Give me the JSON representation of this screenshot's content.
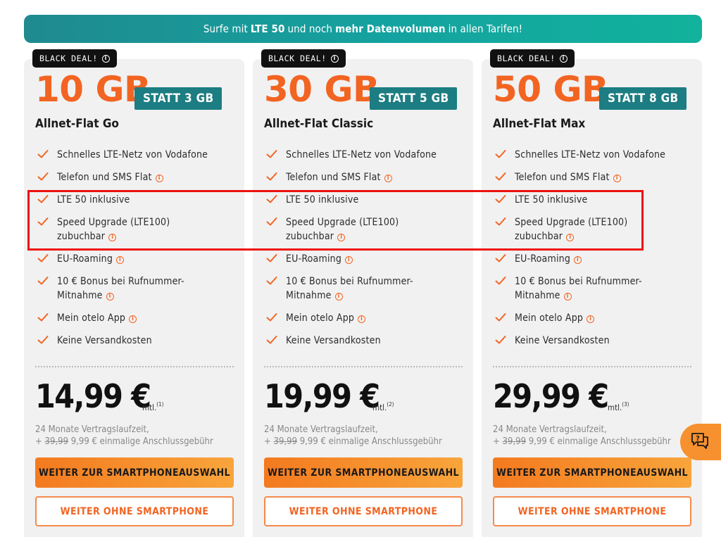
{
  "banner": {
    "text_1": "Surfe mit",
    "bold_1": "LTE 50",
    "text_2": "und noch",
    "bold_2": "mehr Datenvolumen",
    "text_3": "in allen Tarifen!"
  },
  "colors": {
    "accent_orange": "#f26422",
    "teal": "#1c7d82",
    "highlight_red": "#ee1111"
  },
  "plans": [
    {
      "deal_label": "BLACK DEAL!",
      "data_volume": "10 GB",
      "statt": "STATT 3 GB",
      "name": "Allnet-Flat Go",
      "features": [
        {
          "line1": "Schnelles LTE-Netz von Vodafone",
          "line2": "",
          "info": false
        },
        {
          "line1": "Telefon und SMS Flat",
          "line2": "",
          "info": true
        },
        {
          "line1": "LTE 50 inklusive",
          "line2": "",
          "info": false
        },
        {
          "line1": "Speed Upgrade (LTE100)",
          "line2": "zubuchbar",
          "info": true
        },
        {
          "line1": "EU-Roaming",
          "line2": "",
          "info": true
        },
        {
          "line1": "10 € Bonus bei Rufnummer-",
          "line2": "Mitnahme",
          "info": true
        },
        {
          "line1": "Mein otelo App",
          "line2": "",
          "info": true
        },
        {
          "line1": "Keine Versandkosten",
          "line2": "",
          "info": false
        }
      ],
      "price": "14,99 €",
      "price_suffix": "mtl.",
      "footnote": "(1)",
      "term": "24 Monate Vertragslaufzeit,",
      "fee_prefix": "+",
      "fee_struck": "39,99",
      "fee": "9,99 € einmalige Anschlussgebühr",
      "primary_cta": "WEITER ZUR SMARTPHONEAUSWAHL",
      "secondary_cta": "WEITER OHNE SMARTPHONE"
    },
    {
      "deal_label": "BLACK DEAL!",
      "data_volume": "30 GB",
      "statt": "STATT 5 GB",
      "name": "Allnet-Flat Classic",
      "features": [
        {
          "line1": "Schnelles LTE-Netz von Vodafone",
          "line2": "",
          "info": false
        },
        {
          "line1": "Telefon und SMS Flat",
          "line2": "",
          "info": true
        },
        {
          "line1": "LTE 50 inklusive",
          "line2": "",
          "info": false
        },
        {
          "line1": "Speed Upgrade (LTE100)",
          "line2": "zubuchbar",
          "info": true
        },
        {
          "line1": "EU-Roaming",
          "line2": "",
          "info": true
        },
        {
          "line1": "10 € Bonus bei Rufnummer-",
          "line2": "Mitnahme",
          "info": true
        },
        {
          "line1": "Mein otelo App",
          "line2": "",
          "info": true
        },
        {
          "line1": "Keine Versandkosten",
          "line2": "",
          "info": false
        }
      ],
      "price": "19,99 €",
      "price_suffix": "mtl.",
      "footnote": "(2)",
      "term": "24 Monate Vertragslaufzeit,",
      "fee_prefix": "+",
      "fee_struck": "39,99",
      "fee": "9,99 € einmalige Anschlussgebühr",
      "primary_cta": "WEITER ZUR SMARTPHONEAUSWAHL",
      "secondary_cta": "WEITER OHNE SMARTPHONE"
    },
    {
      "deal_label": "BLACK DEAL!",
      "data_volume": "50 GB",
      "statt": "STATT 8 GB",
      "name": "Allnet-Flat Max",
      "features": [
        {
          "line1": "Schnelles LTE-Netz von Vodafone",
          "line2": "",
          "info": false
        },
        {
          "line1": "Telefon und SMS Flat",
          "line2": "",
          "info": true
        },
        {
          "line1": "LTE 50 inklusive",
          "line2": "",
          "info": false
        },
        {
          "line1": "Speed Upgrade (LTE100)",
          "line2": "zubuchbar",
          "info": true
        },
        {
          "line1": "EU-Roaming",
          "line2": "",
          "info": true
        },
        {
          "line1": "10 € Bonus bei Rufnummer-",
          "line2": "Mitnahme",
          "info": true
        },
        {
          "line1": "Mein otelo App",
          "line2": "",
          "info": true
        },
        {
          "line1": "Keine Versandkosten",
          "line2": "",
          "info": false
        }
      ],
      "price": "29,99 €",
      "price_suffix": "mtl.",
      "footnote": "(3)",
      "term": "24 Monate Vertragslaufzeit,",
      "fee_prefix": "+",
      "fee_struck": "39,99",
      "fee": "9,99 € einmalige Anschlussgebühr",
      "primary_cta": "WEITER ZUR SMARTPHONEAUSWAHL",
      "secondary_cta": "WEITER OHNE SMARTPHONE"
    }
  ],
  "chat": {
    "icon": "chat-help-icon"
  }
}
